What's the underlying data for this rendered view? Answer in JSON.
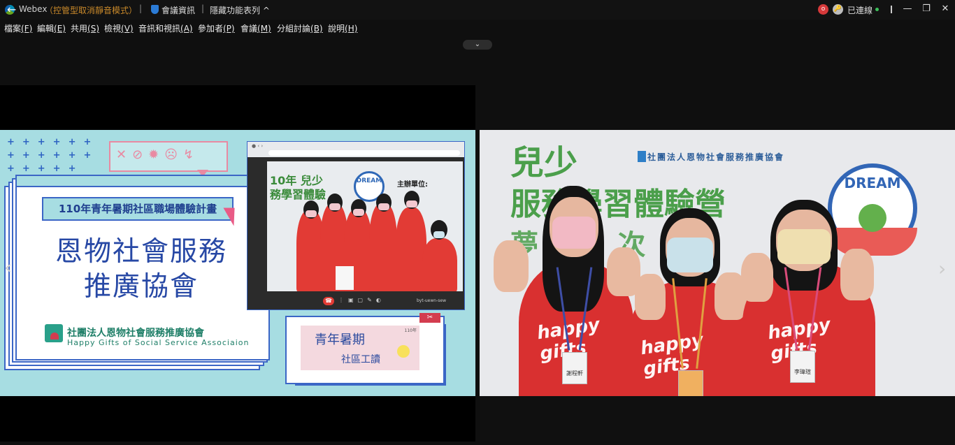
{
  "titlebar": {
    "app_name": "Webex",
    "mode": "（控管型取消靜音模式）",
    "meeting_info": "會議資訊",
    "hide_menu": "隱藏功能表列 ^",
    "status": "已連線",
    "rec_badge": "o",
    "lock_badge": "🔑"
  },
  "menubar": {
    "items": [
      {
        "label": "檔案",
        "key": "(F)"
      },
      {
        "label": "編輯",
        "key": "(E)"
      },
      {
        "label": "共用",
        "key": "(S)"
      },
      {
        "label": "檢視",
        "key": "(V)"
      },
      {
        "label": "音訊和視訊",
        "key": "(A)"
      },
      {
        "label": "參加者",
        "key": "(P)"
      },
      {
        "label": "會議",
        "key": "(M)"
      },
      {
        "label": "分組討論",
        "key": "(B)"
      },
      {
        "label": "說明",
        "key": "(H)"
      }
    ]
  },
  "share": {
    "plan_title": "110年青年暑期社區職場體驗計畫",
    "org_line1": "恩物社會服務",
    "org_line2": "推廣協會",
    "org_full_zh": "社團法人恩物社會服務推廣協會",
    "org_full_en": "Happy Gifts of Social Service Associaion",
    "inner_wall_text_1": "10年 兒少",
    "inner_wall_text_2": "務學習體驗",
    "inner_sponsor": "主辦單位:",
    "inner_dream": "DREAM",
    "inner_name": "byt-uewn-sew",
    "youth_line1": "青年暑期",
    "youth_line2": "社區工讀",
    "youth_badge": "110年"
  },
  "video": {
    "wall_line1": "兒少",
    "wall_line2": "服務學習體驗營",
    "wall_line3": "夢　N　次",
    "wall_org": "社團法人恩物社會服務推廣協會",
    "dream": "DREAM",
    "shirt_text": "happy gifts",
    "badge_1": "謝程軒",
    "badge_2": "",
    "badge_3": "李瑋瑄"
  },
  "colors": {
    "share_bg": "#a7dde2",
    "accent_blue": "#3b66c6",
    "shirt_red": "#d93030",
    "wall_green": "#4b9f4b"
  }
}
